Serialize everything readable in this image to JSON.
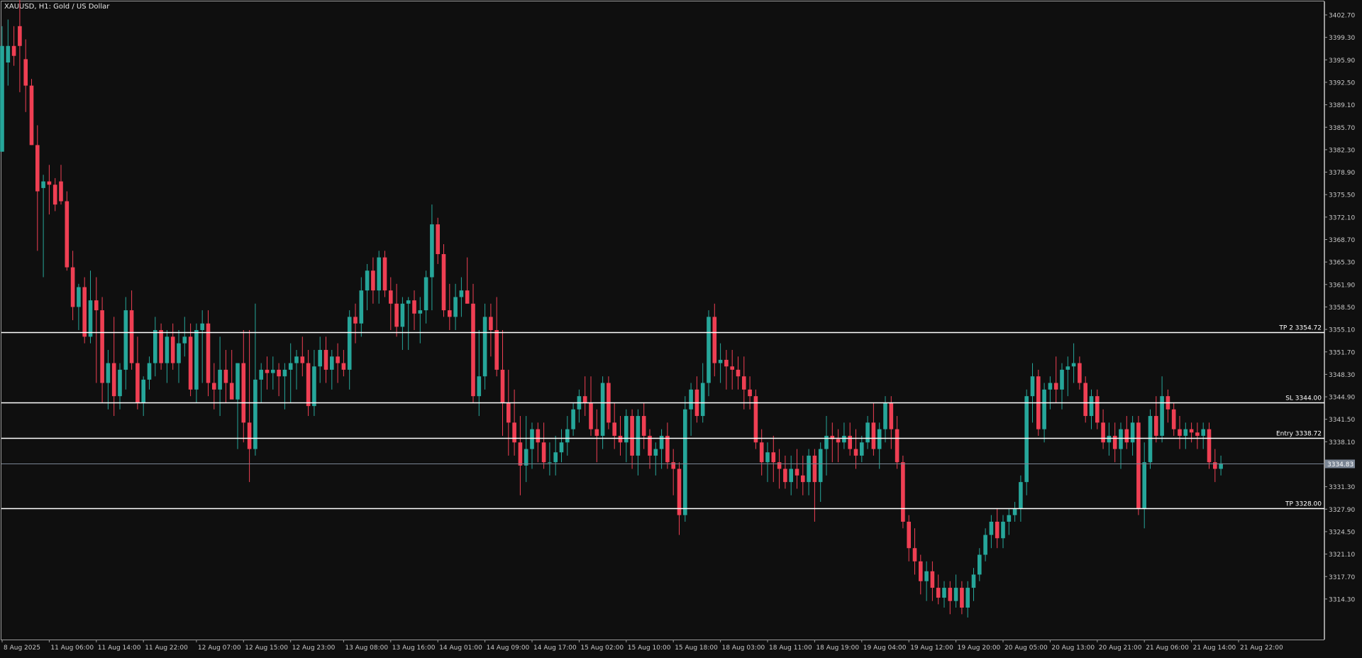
{
  "header": {
    "symbol_label": "XAUUSD, H1:  Gold / US Dollar"
  },
  "colors": {
    "background": "#0f0f0f",
    "bull": "#26a69a",
    "bear": "#ef3f53",
    "level_line": "#ffffff",
    "axis_text": "#c8c8c8",
    "current_price_bg": "#7a8594"
  },
  "chart_data": {
    "type": "candlestick",
    "symbol": "XAUUSD",
    "timeframe": "H1",
    "ylim": [
      3311.0,
      3405.0
    ],
    "y_ticks": [
      "3402.70",
      "3399.30",
      "3395.90",
      "3392.50",
      "3389.10",
      "3385.70",
      "3382.30",
      "3378.90",
      "3375.50",
      "3372.10",
      "3368.70",
      "3365.30",
      "3361.90",
      "3358.50",
      "3355.10",
      "3351.70",
      "3348.30",
      "3344.90",
      "3341.50",
      "3338.10",
      "3334.70",
      "3331.30",
      "3327.90",
      "3324.50",
      "3321.10",
      "3317.70",
      "3314.30"
    ],
    "x_ticks": [
      {
        "label": "8 Aug 2025",
        "index": 0
      },
      {
        "label": "11 Aug 06:00",
        "index": 8
      },
      {
        "label": "11 Aug 14:00",
        "index": 16
      },
      {
        "label": "11 Aug 22:00",
        "index": 24
      },
      {
        "label": "12 Aug 07:00",
        "index": 33
      },
      {
        "label": "12 Aug 15:00",
        "index": 41
      },
      {
        "label": "12 Aug 23:00",
        "index": 49
      },
      {
        "label": "13 Aug 08:00",
        "index": 58
      },
      {
        "label": "13 Aug 16:00",
        "index": 66
      },
      {
        "label": "14 Aug 01:00",
        "index": 74
      },
      {
        "label": "14 Aug 09:00",
        "index": 82
      },
      {
        "label": "14 Aug 17:00",
        "index": 90
      },
      {
        "label": "15 Aug 02:00",
        "index": 98
      },
      {
        "label": "15 Aug 10:00",
        "index": 106
      },
      {
        "label": "15 Aug 18:00",
        "index": 114
      },
      {
        "label": "18 Aug 03:00",
        "index": 122
      },
      {
        "label": "18 Aug 11:00",
        "index": 130
      },
      {
        "label": "18 Aug 19:00",
        "index": 138
      },
      {
        "label": "19 Aug 04:00",
        "index": 146
      },
      {
        "label": "19 Aug 12:00",
        "index": 154
      },
      {
        "label": "19 Aug 20:00",
        "index": 162
      },
      {
        "label": "20 Aug 05:00",
        "index": 170
      },
      {
        "label": "20 Aug 13:00",
        "index": 178
      },
      {
        "label": "20 Aug 21:00",
        "index": 186
      },
      {
        "label": "21 Aug 06:00",
        "index": 194
      },
      {
        "label": "21 Aug 14:00",
        "index": 202
      },
      {
        "label": "21 Aug 22:00",
        "index": 210
      }
    ],
    "levels": [
      {
        "label": "TP 2 3354.72",
        "price": 3354.72
      },
      {
        "label": "SL 3344.00",
        "price": 3344.0
      },
      {
        "label": "Entry 3338.72",
        "price": 3338.72
      },
      {
        "label": "TP 3328.00",
        "price": 3328.0
      }
    ],
    "current_price": {
      "label": "3334.83",
      "price": 3334.83
    },
    "ohlc": [
      [
        3382.0,
        3401.0,
        3382.0,
        3398.0
      ],
      [
        3395.5,
        3402.0,
        3392.0,
        3398.0
      ],
      [
        3398.0,
        3401.0,
        3395.0,
        3396.5
      ],
      [
        3401.0,
        3405.0,
        3391.0,
        3398.0
      ],
      [
        3396.0,
        3399.0,
        3388.0,
        3392.0
      ],
      [
        3392.0,
        3393.0,
        3383.0,
        3383.0
      ],
      [
        3383.0,
        3386.0,
        3367.0,
        3376.0
      ],
      [
        3376.5,
        3378.5,
        3363.0,
        3377.5
      ],
      [
        3377.5,
        3380.0,
        3372.5,
        3377.0
      ],
      [
        3377.0,
        3378.0,
        3373.0,
        3374.0
      ],
      [
        3377.5,
        3380.0,
        3374.0,
        3374.5
      ],
      [
        3374.5,
        3376.0,
        3364.0,
        3364.5
      ],
      [
        3364.5,
        3367.0,
        3356.5,
        3358.5
      ],
      [
        3358.5,
        3362.0,
        3355.0,
        3361.5
      ],
      [
        3361.5,
        3363.0,
        3353.0,
        3354.0
      ],
      [
        3354.0,
        3364.0,
        3353.0,
        3359.5
      ],
      [
        3359.5,
        3363.0,
        3347.0,
        3358.0
      ],
      [
        3358.0,
        3360.0,
        3344.0,
        3347.0
      ],
      [
        3347.0,
        3352.0,
        3343.0,
        3350.0
      ],
      [
        3350.0,
        3357.0,
        3342.0,
        3345.0
      ],
      [
        3345.0,
        3350.0,
        3343.0,
        3349.0
      ],
      [
        3349.0,
        3360.0,
        3346.0,
        3358.0
      ],
      [
        3358.0,
        3361.0,
        3349.0,
        3350.0
      ],
      [
        3350.0,
        3354.0,
        3343.0,
        3344.0
      ],
      [
        3344.0,
        3348.0,
        3342.0,
        3347.5
      ],
      [
        3347.5,
        3351.0,
        3346.0,
        3350.0
      ],
      [
        3350.0,
        3357.0,
        3348.0,
        3355.0
      ],
      [
        3355.0,
        3356.0,
        3349.0,
        3350.0
      ],
      [
        3350.0,
        3355.0,
        3347.0,
        3354.0
      ],
      [
        3354.0,
        3356.0,
        3349.0,
        3350.0
      ],
      [
        3350.0,
        3355.0,
        3347.0,
        3353.0
      ],
      [
        3353.0,
        3357.0,
        3351.0,
        3354.0
      ],
      [
        3354.0,
        3356.0,
        3345.0,
        3346.0
      ],
      [
        3346.0,
        3356.0,
        3344.0,
        3355.0
      ],
      [
        3355.0,
        3358.0,
        3347.0,
        3356.0
      ],
      [
        3356.0,
        3358.0,
        3345.0,
        3347.0
      ],
      [
        3347.0,
        3350.0,
        3343.0,
        3346.0
      ],
      [
        3346.0,
        3354.0,
        3342.0,
        3349.0
      ],
      [
        3349.0,
        3352.0,
        3344.0,
        3347.0
      ],
      [
        3347.0,
        3352.0,
        3345.0,
        3344.5
      ],
      [
        3344.5,
        3349.0,
        3337.0,
        3350.0
      ],
      [
        3350.0,
        3355.0,
        3338.0,
        3341.0
      ],
      [
        3341.0,
        3355.0,
        3332.0,
        3337.0
      ],
      [
        3337.0,
        3359.0,
        3336.0,
        3347.5
      ],
      [
        3347.5,
        3350.0,
        3344.0,
        3349.0
      ],
      [
        3349.0,
        3351.0,
        3346.0,
        3348.5
      ],
      [
        3348.5,
        3351.0,
        3346.0,
        3349.0
      ],
      [
        3349.0,
        3350.0,
        3345.0,
        3348.0
      ],
      [
        3348.0,
        3350.0,
        3343.0,
        3349.0
      ],
      [
        3349.0,
        3353.0,
        3344.0,
        3350.0
      ],
      [
        3350.0,
        3352.0,
        3346.0,
        3351.0
      ],
      [
        3351.0,
        3354.0,
        3348.0,
        3350.0
      ],
      [
        3350.0,
        3352.0,
        3342.0,
        3343.5
      ],
      [
        3343.5,
        3352.0,
        3342.0,
        3349.5
      ],
      [
        3349.5,
        3354.0,
        3347.0,
        3352.0
      ],
      [
        3352.0,
        3354.0,
        3347.0,
        3349.0
      ],
      [
        3349.0,
        3352.0,
        3346.0,
        3351.0
      ],
      [
        3351.0,
        3353.0,
        3347.0,
        3350.0
      ],
      [
        3350.0,
        3352.0,
        3348.0,
        3349.0
      ],
      [
        3349.0,
        3358.0,
        3346.0,
        3357.0
      ],
      [
        3357.0,
        3359.0,
        3353.0,
        3356.0
      ],
      [
        3356.0,
        3363.0,
        3354.0,
        3361.0
      ],
      [
        3361.0,
        3365.0,
        3358.0,
        3364.0
      ],
      [
        3364.0,
        3366.0,
        3359.0,
        3361.0
      ],
      [
        3361.0,
        3367.0,
        3359.0,
        3366.0
      ],
      [
        3366.0,
        3367.0,
        3360.0,
        3361.0
      ],
      [
        3361.0,
        3363.0,
        3355.0,
        3359.0
      ],
      [
        3359.0,
        3362.0,
        3354.0,
        3355.5
      ],
      [
        3355.5,
        3360.0,
        3352.0,
        3359.0
      ],
      [
        3359.0,
        3360.0,
        3352.0,
        3359.5
      ],
      [
        3359.5,
        3361.0,
        3355.0,
        3357.5
      ],
      [
        3357.5,
        3360.0,
        3353.0,
        3358.0
      ],
      [
        3358.0,
        3364.0,
        3356.0,
        3363.0
      ],
      [
        3363.0,
        3374.0,
        3358.0,
        3371.0
      ],
      [
        3371.0,
        3372.0,
        3365.0,
        3366.5
      ],
      [
        3366.5,
        3368.0,
        3357.0,
        3358.0
      ],
      [
        3358.0,
        3362.0,
        3355.0,
        3357.0
      ],
      [
        3357.0,
        3362.0,
        3355.0,
        3360.0
      ],
      [
        3360.0,
        3363.0,
        3357.0,
        3361.0
      ],
      [
        3361.0,
        3366.0,
        3359.0,
        3359.0
      ],
      [
        3359.0,
        3362.0,
        3344.0,
        3345.0
      ],
      [
        3345.0,
        3355.0,
        3342.0,
        3348.0
      ],
      [
        3348.0,
        3359.0,
        3346.0,
        3357.0
      ],
      [
        3357.0,
        3359.0,
        3351.0,
        3355.0
      ],
      [
        3355.0,
        3360.0,
        3348.0,
        3349.0
      ],
      [
        3349.0,
        3355.0,
        3339.0,
        3344.0
      ],
      [
        3344.0,
        3349.0,
        3336.0,
        3341.0
      ],
      [
        3341.0,
        3346.0,
        3336.0,
        3338.0
      ],
      [
        3338.0,
        3342.0,
        3330.0,
        3334.5
      ],
      [
        3334.5,
        3342.0,
        3332.0,
        3337.0
      ],
      [
        3337.0,
        3341.0,
        3334.0,
        3340.0
      ],
      [
        3340.0,
        3341.0,
        3335.0,
        3338.0
      ],
      [
        3338.0,
        3341.0,
        3334.0,
        3335.0
      ],
      [
        3335.0,
        3338.0,
        3333.0,
        3335.0
      ],
      [
        3335.0,
        3339.0,
        3333.0,
        3336.5
      ],
      [
        3336.5,
        3340.0,
        3335.0,
        3338.0
      ],
      [
        3338.0,
        3342.0,
        3336.0,
        3340.0
      ],
      [
        3340.0,
        3344.0,
        3339.0,
        3343.0
      ],
      [
        3343.0,
        3346.0,
        3341.0,
        3345.0
      ],
      [
        3345.0,
        3348.0,
        3342.0,
        3344.0
      ],
      [
        3344.0,
        3348.0,
        3339.0,
        3340.0
      ],
      [
        3340.0,
        3343.0,
        3335.0,
        3339.0
      ],
      [
        3339.0,
        3348.0,
        3337.0,
        3347.0
      ],
      [
        3347.0,
        3348.0,
        3340.0,
        3341.0
      ],
      [
        3341.0,
        3344.0,
        3337.0,
        3339.0
      ],
      [
        3339.0,
        3342.0,
        3336.0,
        3338.0
      ],
      [
        3338.0,
        3343.0,
        3335.0,
        3342.0
      ],
      [
        3342.0,
        3343.0,
        3334.0,
        3336.0
      ],
      [
        3336.0,
        3343.0,
        3333.0,
        3342.0
      ],
      [
        3342.0,
        3344.0,
        3337.0,
        3339.0
      ],
      [
        3339.0,
        3340.0,
        3334.0,
        3336.0
      ],
      [
        3336.0,
        3338.0,
        3333.0,
        3337.0
      ],
      [
        3337.0,
        3340.0,
        3334.0,
        3339.0
      ],
      [
        3339.0,
        3341.0,
        3334.0,
        3335.0
      ],
      [
        3335.0,
        3337.0,
        3330.0,
        3334.0
      ],
      [
        3334.0,
        3335.0,
        3324.0,
        3327.0
      ],
      [
        3327.0,
        3345.0,
        3326.0,
        3343.0
      ],
      [
        3343.0,
        3347.0,
        3339.0,
        3346.0
      ],
      [
        3346.0,
        3348.0,
        3341.0,
        3342.0
      ],
      [
        3342.0,
        3350.0,
        3341.0,
        3347.0
      ],
      [
        3347.0,
        3358.0,
        3345.0,
        3357.0
      ],
      [
        3357.0,
        3359.0,
        3348.0,
        3350.0
      ],
      [
        3350.0,
        3353.0,
        3347.0,
        3350.5
      ],
      [
        3350.5,
        3352.0,
        3346.0,
        3349.5
      ],
      [
        3349.5,
        3352.0,
        3346.0,
        3349.0
      ],
      [
        3349.0,
        3351.0,
        3346.0,
        3348.0
      ],
      [
        3348.0,
        3351.0,
        3343.0,
        3346.0
      ],
      [
        3346.0,
        3348.0,
        3343.0,
        3345.0
      ],
      [
        3345.0,
        3346.0,
        3337.0,
        3338.0
      ],
      [
        3338.0,
        3340.0,
        3333.0,
        3335.0
      ],
      [
        3335.0,
        3338.0,
        3332.0,
        3336.5
      ],
      [
        3336.5,
        3339.0,
        3332.0,
        3335.0
      ],
      [
        3335.0,
        3337.0,
        3331.0,
        3334.0
      ],
      [
        3334.0,
        3336.0,
        3331.0,
        3332.0
      ],
      [
        3332.0,
        3336.0,
        3330.0,
        3334.0
      ],
      [
        3334.0,
        3337.0,
        3331.0,
        3333.0
      ],
      [
        3333.0,
        3336.0,
        3330.0,
        3332.0
      ],
      [
        3332.0,
        3337.0,
        3330.0,
        3336.0
      ],
      [
        3336.0,
        3337.0,
        3326.0,
        3332.0
      ],
      [
        3332.0,
        3338.0,
        3329.0,
        3337.0
      ],
      [
        3337.0,
        3342.0,
        3333.0,
        3339.0
      ],
      [
        3339.0,
        3341.0,
        3335.0,
        3338.5
      ],
      [
        3338.5,
        3340.0,
        3335.0,
        3338.0
      ],
      [
        3338.0,
        3341.0,
        3337.0,
        3339.0
      ],
      [
        3339.0,
        3341.0,
        3336.0,
        3337.0
      ],
      [
        3337.0,
        3340.0,
        3334.0,
        3336.0
      ],
      [
        3336.0,
        3339.0,
        3335.0,
        3338.0
      ],
      [
        3338.0,
        3342.0,
        3337.0,
        3341.0
      ],
      [
        3341.0,
        3344.0,
        3336.0,
        3337.0
      ],
      [
        3337.0,
        3341.0,
        3334.0,
        3340.0
      ],
      [
        3340.0,
        3345.0,
        3338.0,
        3344.0
      ],
      [
        3344.0,
        3345.0,
        3337.0,
        3340.0
      ],
      [
        3340.0,
        3342.0,
        3334.0,
        3335.0
      ],
      [
        3335.0,
        3336.0,
        3325.0,
        3326.0
      ],
      [
        3326.0,
        3327.0,
        3320.0,
        3322.0
      ],
      [
        3322.0,
        3325.0,
        3318.0,
        3320.0
      ],
      [
        3320.0,
        3321.0,
        3315.0,
        3317.0
      ],
      [
        3317.0,
        3320.0,
        3314.0,
        3318.5
      ],
      [
        3318.5,
        3320.0,
        3314.0,
        3316.0
      ],
      [
        3316.0,
        3318.0,
        3313.5,
        3314.5
      ],
      [
        3314.5,
        3317.0,
        3313.0,
        3316.0
      ],
      [
        3316.0,
        3317.0,
        3312.0,
        3314.0
      ],
      [
        3314.0,
        3318.0,
        3313.0,
        3316.0
      ],
      [
        3316.0,
        3317.0,
        3312.0,
        3313.0
      ],
      [
        3313.0,
        3317.0,
        3311.5,
        3316.0
      ],
      [
        3316.0,
        3319.0,
        3314.0,
        3318.0
      ],
      [
        3318.0,
        3322.0,
        3317.0,
        3321.0
      ],
      [
        3321.0,
        3325.0,
        3320.0,
        3324.0
      ],
      [
        3324.0,
        3327.0,
        3322.0,
        3326.0
      ],
      [
        3326.0,
        3328.0,
        3322.0,
        3323.5
      ],
      [
        3323.5,
        3327.0,
        3322.0,
        3326.0
      ],
      [
        3326.0,
        3328.0,
        3324.0,
        3327.0
      ],
      [
        3327.0,
        3329.0,
        3326.0,
        3328.0
      ],
      [
        3328.0,
        3333.0,
        3326.0,
        3332.0
      ],
      [
        3332.0,
        3346.0,
        3330.0,
        3345.0
      ],
      [
        3345.0,
        3350.0,
        3341.0,
        3348.0
      ],
      [
        3348.0,
        3349.0,
        3339.0,
        3340.0
      ],
      [
        3340.0,
        3347.0,
        3338.0,
        3346.0
      ],
      [
        3346.0,
        3348.0,
        3343.0,
        3347.0
      ],
      [
        3347.0,
        3351.0,
        3344.0,
        3346.0
      ],
      [
        3346.0,
        3350.0,
        3343.0,
        3349.0
      ],
      [
        3349.0,
        3351.0,
        3345.0,
        3349.5
      ],
      [
        3349.5,
        3353.0,
        3347.0,
        3350.0
      ],
      [
        3350.0,
        3351.0,
        3346.0,
        3347.0
      ],
      [
        3347.0,
        3348.0,
        3341.0,
        3342.0
      ],
      [
        3342.0,
        3346.0,
        3340.0,
        3345.0
      ],
      [
        3345.0,
        3346.0,
        3340.0,
        3341.0
      ],
      [
        3341.0,
        3343.0,
        3337.0,
        3338.0
      ],
      [
        3338.0,
        3341.0,
        3336.0,
        3339.0
      ],
      [
        3339.0,
        3341.0,
        3335.0,
        3337.0
      ],
      [
        3337.0,
        3341.0,
        3334.0,
        3340.0
      ],
      [
        3340.0,
        3342.0,
        3337.0,
        3338.0
      ],
      [
        3338.0,
        3342.0,
        3336.0,
        3341.0
      ],
      [
        3341.0,
        3342.0,
        3327.0,
        3328.0
      ],
      [
        3328.0,
        3338.0,
        3325.0,
        3335.0
      ],
      [
        3335.0,
        3343.0,
        3334.0,
        3342.0
      ],
      [
        3342.0,
        3345.0,
        3338.0,
        3339.0
      ],
      [
        3339.0,
        3348.0,
        3338.0,
        3345.0
      ],
      [
        3345.0,
        3346.0,
        3341.0,
        3343.0
      ],
      [
        3343.0,
        3344.0,
        3339.0,
        3340.0
      ],
      [
        3340.0,
        3342.0,
        3337.0,
        3339.0
      ],
      [
        3339.0,
        3341.0,
        3337.0,
        3340.0
      ],
      [
        3340.0,
        3341.0,
        3338.0,
        3339.5
      ],
      [
        3339.5,
        3341.0,
        3337.0,
        3339.0
      ],
      [
        3339.0,
        3341.0,
        3337.0,
        3340.0
      ],
      [
        3340.0,
        3341.0,
        3334.0,
        3335.0
      ],
      [
        3335.0,
        3337.0,
        3332.0,
        3334.0
      ],
      [
        3334.0,
        3336.0,
        3333.0,
        3334.83
      ]
    ]
  }
}
